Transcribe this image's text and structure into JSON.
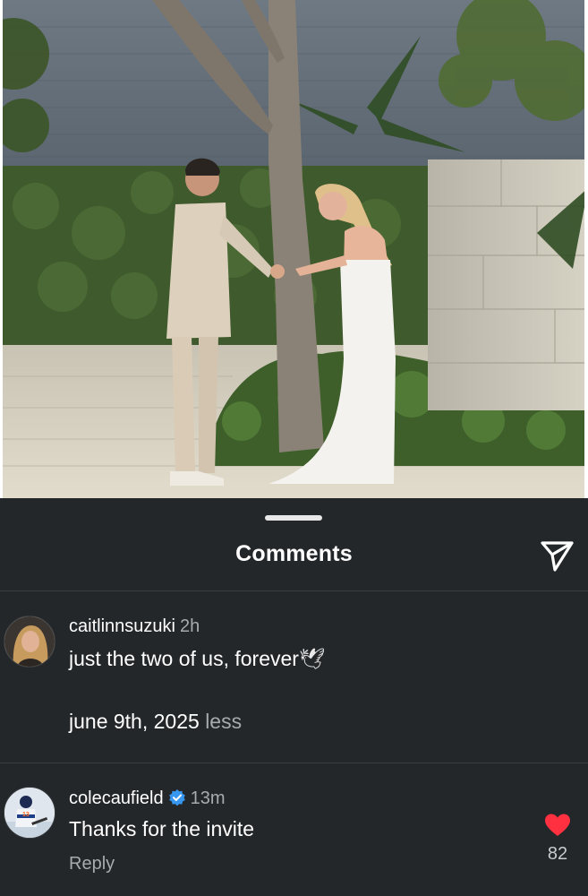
{
  "post": {
    "photo_icon": "wedding-photo"
  },
  "sheet": {
    "title": "Comments",
    "share_icon": "send-icon"
  },
  "comments": [
    {
      "username": "caitlinnsuzuki",
      "time": "2h",
      "text_line1": "just the two of us, forever",
      "emoji": "🕊",
      "text_line2": "june 9th, 2025",
      "less_label": "less"
    },
    {
      "username": "colecaufield",
      "verified": true,
      "time": "13m",
      "text": "Thanks for the invite",
      "reply_label": "Reply",
      "like_count": "82",
      "like_color": "#ff3040"
    }
  ]
}
